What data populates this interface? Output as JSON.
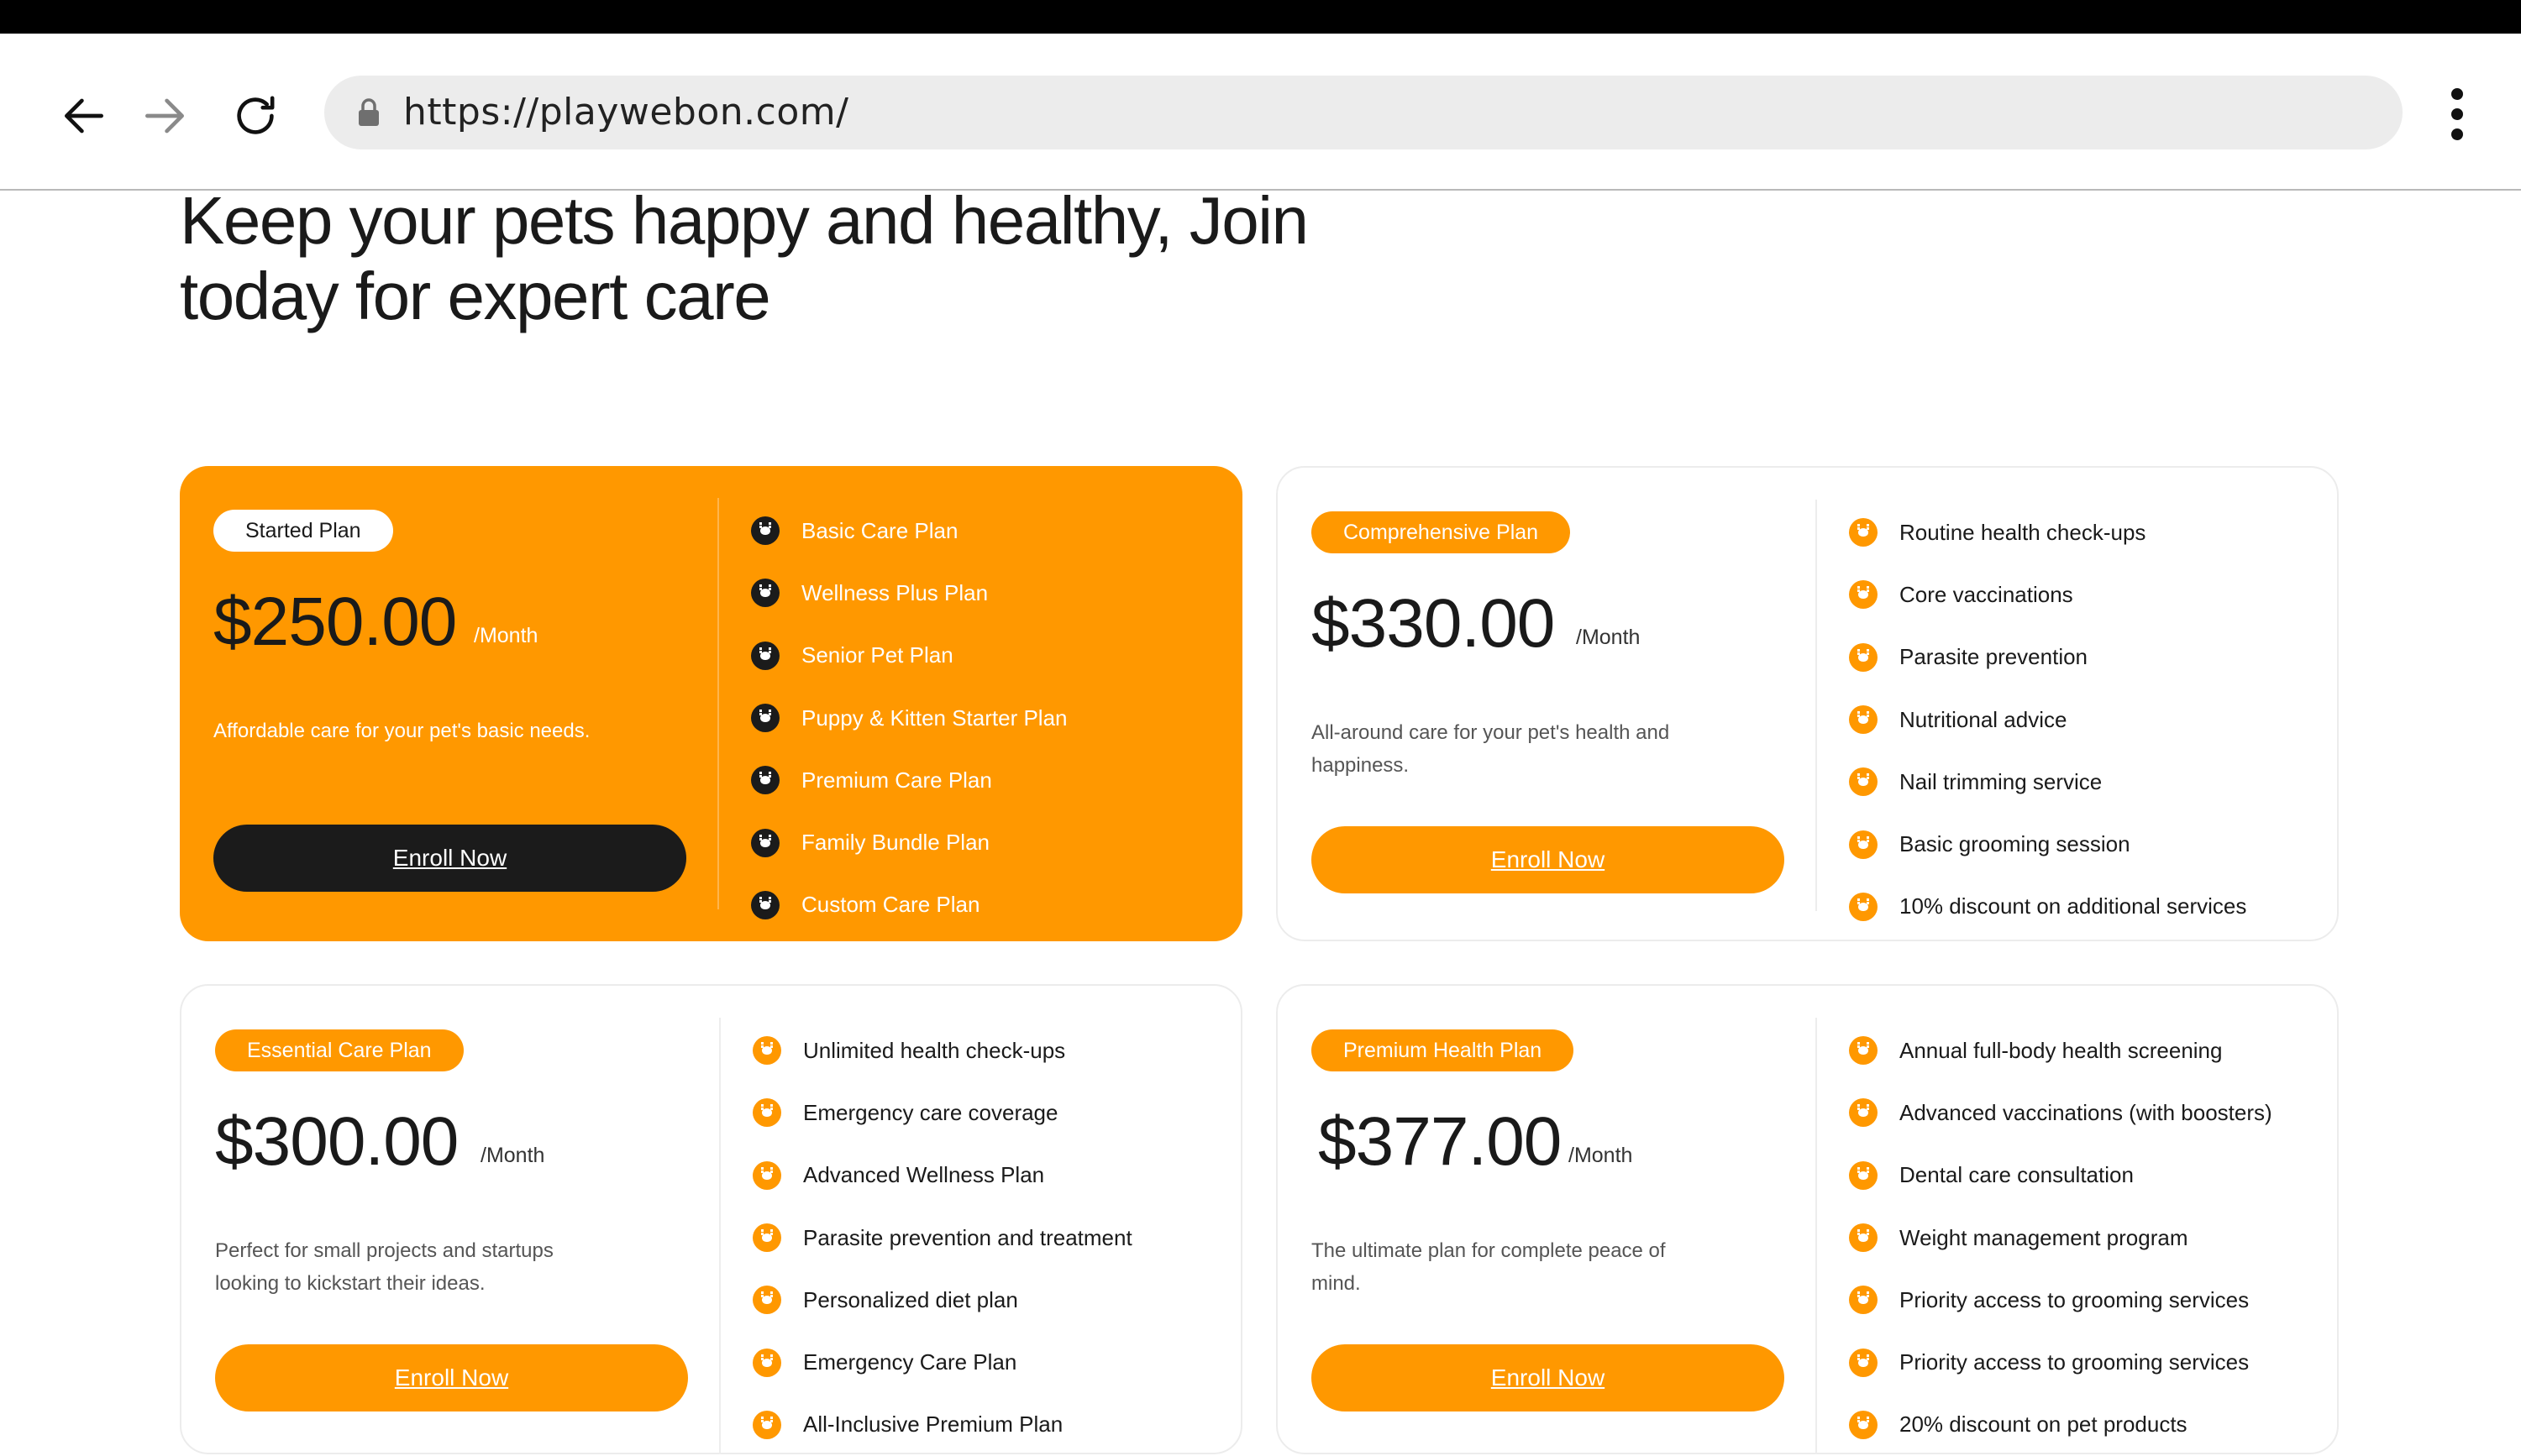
{
  "browser": {
    "url": "https://playwebon.com/"
  },
  "page": {
    "headline": "Keep your pets happy and healthy, Join today for expert care"
  },
  "plans": [
    {
      "badge": "Started Plan",
      "price": "$250.00",
      "period": "/Month",
      "description": "Affordable care for your pet's basic needs.",
      "cta": "Enroll Now",
      "features": [
        "Basic Care Plan",
        "Wellness Plus Plan",
        "Senior Pet Plan",
        "Puppy & Kitten Starter Plan",
        "Premium Care Plan",
        "Family Bundle Plan",
        "Custom Care Plan"
      ]
    },
    {
      "badge": "Comprehensive Plan",
      "price": "$330.00",
      "period": "/Month",
      "description": "All-around care for your pet's health and happiness.",
      "cta": "Enroll Now",
      "features": [
        "Routine health check-ups",
        "Core vaccinations",
        "Parasite prevention",
        "Nutritional advice",
        "Nail trimming service",
        "Basic grooming session",
        "10% discount on additional services"
      ]
    },
    {
      "badge": "Essential Care Plan",
      "price": "$300.00",
      "period": "/Month",
      "description": "Perfect for small projects and startups looking to kickstart their ideas.",
      "cta": "Enroll Now",
      "features": [
        "Unlimited health check-ups",
        "Emergency care coverage",
        "Advanced Wellness Plan",
        "Parasite prevention and treatment",
        "Personalized diet plan",
        "Emergency Care Plan",
        "All-Inclusive Premium Plan"
      ]
    },
    {
      "badge": "Premium Health Plan",
      "price": "$377.00",
      "period": "/Month",
      "description": "The ultimate plan for complete peace of mind.",
      "cta": "Enroll Now",
      "features": [
        "Annual full-body health screening",
        "Advanced vaccinations (with boosters)",
        "Dental care consultation",
        "Weight management program",
        "Priority access to grooming services",
        "Priority access to grooming services",
        "20% discount on pet products"
      ]
    }
  ],
  "colors": {
    "accent": "#ff9800",
    "dark": "#1b1b1b"
  }
}
